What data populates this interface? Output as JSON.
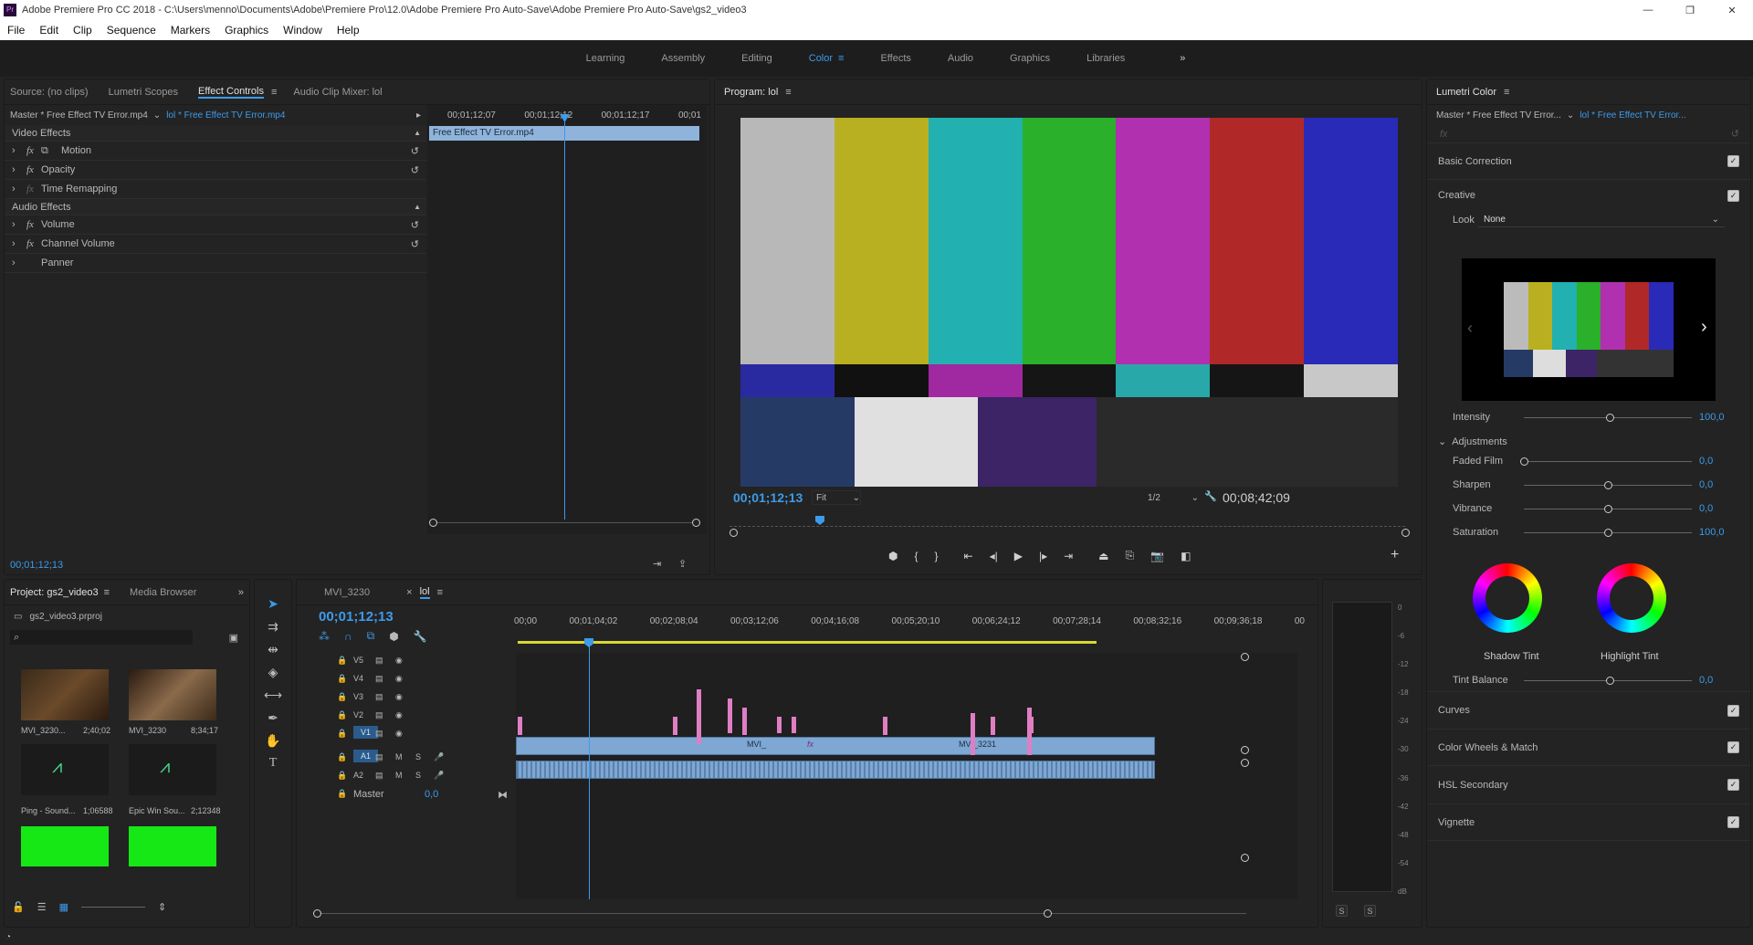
{
  "window": {
    "title": "Adobe Premiere Pro CC 2018 - C:\\Users\\menno\\Documents\\Adobe\\Premiere Pro\\12.0\\Adobe Premiere Pro Auto-Save\\Adobe Premiere Pro Auto-Save\\gs2_video3",
    "app_icon": "Pr"
  },
  "menu": [
    "File",
    "Edit",
    "Clip",
    "Sequence",
    "Markers",
    "Graphics",
    "Window",
    "Help"
  ],
  "workspaces": [
    "Learning",
    "Assembly",
    "Editing",
    "Color",
    "Effects",
    "Audio",
    "Graphics",
    "Libraries"
  ],
  "workspace_active": "Color",
  "source_panel": {
    "tabs": [
      "Source: (no clips)",
      "Lumetri Scopes",
      "Effect Controls",
      "Audio Clip Mixer: lol"
    ],
    "master_label": "Master * Free Effect  TV Error.mp4",
    "clip_label": "lol * Free Effect  TV Error.mp4",
    "timecodes": [
      "00;01;12;07",
      "00;01;12;12",
      "00;01;12;17",
      "00;01"
    ],
    "clip_bar": "Free Effect  TV Error.mp4",
    "video_effects": "Video Effects",
    "audio_effects": "Audio Effects",
    "effects": [
      "Motion",
      "Opacity",
      "Time Remapping"
    ],
    "audio_items": [
      "Volume",
      "Channel Volume",
      "Panner"
    ],
    "current_time": "00;01;12;13"
  },
  "program": {
    "title": "Program: lol",
    "timecode": "00;01;12;13",
    "fit": "Fit",
    "resolution": "1/2",
    "duration": "00;08;42;09"
  },
  "lumetri": {
    "title": "Lumetri Color",
    "master": "Master * Free Effect  TV Error...",
    "clip": "lol * Free Effect  TV Error...",
    "fx": "fx",
    "sections": [
      "Basic Correction",
      "Creative",
      "Curves",
      "Color Wheels & Match",
      "HSL Secondary",
      "Vignette"
    ],
    "look_label": "Look",
    "look_value": "None",
    "intensity_label": "Intensity",
    "intensity_value": "100,0",
    "adjustments": "Adjustments",
    "sliders": [
      {
        "label": "Faded Film",
        "value": "0,0",
        "pos": 0
      },
      {
        "label": "Sharpen",
        "value": "0,0",
        "pos": 0.5
      },
      {
        "label": "Vibrance",
        "value": "0,0",
        "pos": 0.5
      },
      {
        "label": "Saturation",
        "value": "100,0",
        "pos": 0.5
      }
    ],
    "shadow_tint": "Shadow Tint",
    "highlight_tint": "Highlight Tint",
    "tint_balance_label": "Tint Balance",
    "tint_balance_value": "0,0"
  },
  "project": {
    "tabs": [
      "Project: gs2_video3",
      "Media Browser"
    ],
    "file": "gs2_video3.prproj",
    "items": [
      {
        "name": "MVI_3230...",
        "duration": "2;40;02"
      },
      {
        "name": "MVI_3230",
        "duration": "8;34;17"
      },
      {
        "name": "Ping - Sound...",
        "duration": "1;06588"
      },
      {
        "name": "Epic Win Sou...",
        "duration": "2;12348"
      }
    ]
  },
  "timeline": {
    "tabs": [
      "MVI_3230",
      "lol"
    ],
    "timecode": "00;01;12;13",
    "ruler": [
      "00;00",
      "00;01;04;02",
      "00;02;08;04",
      "00;03;12;06",
      "00;04;16;08",
      "00;05;20;10",
      "00;06;24;12",
      "00;07;28;14",
      "00;08;32;16",
      "00;09;36;18",
      "00"
    ],
    "video_tracks": [
      "V5",
      "V4",
      "V3",
      "V2",
      "V1"
    ],
    "audio_tracks": [
      "A1",
      "A2"
    ],
    "master_label": "Master",
    "master_value": "0,0",
    "clip_labels": [
      "MVI_",
      "fx",
      "MVI_3231"
    ]
  },
  "meter": {
    "scale": [
      "0",
      "-6",
      "-12",
      "-18",
      "-24",
      "-30",
      "-36",
      "-42",
      "-48",
      "-54",
      "dB"
    ],
    "solo": [
      "S",
      "S"
    ]
  }
}
